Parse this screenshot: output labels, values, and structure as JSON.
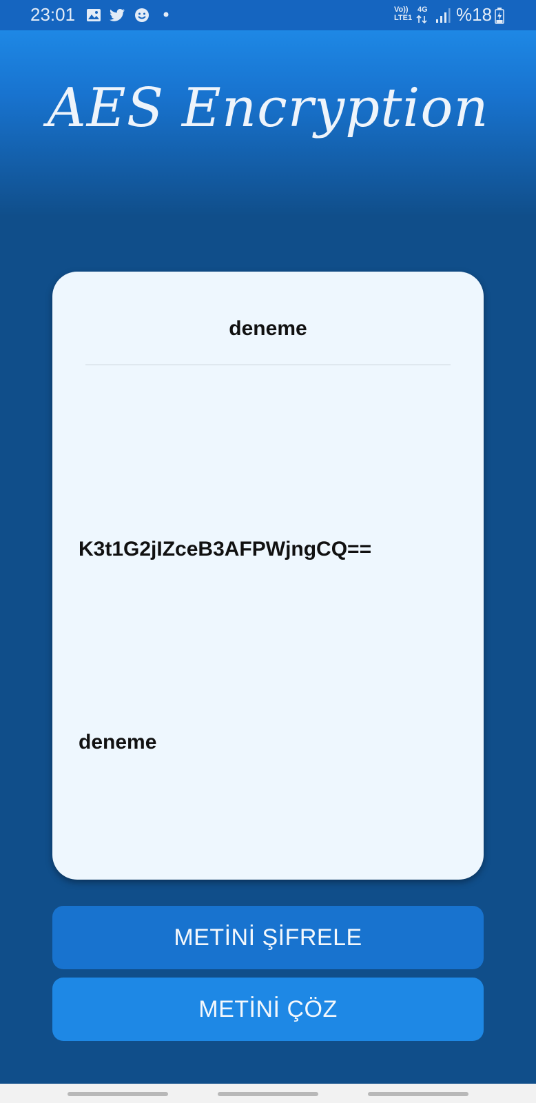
{
  "status_bar": {
    "time": "23:01",
    "notification_icons": [
      "gallery-icon",
      "twitter-icon",
      "smiley-icon",
      "dot-icon"
    ],
    "network_top": "Vo))",
    "network_bottom": "LTE1",
    "data_type": "4G",
    "battery_label": "%18"
  },
  "header": {
    "title": "AES Encryption"
  },
  "card": {
    "input_value": "deneme",
    "encrypted_value": "K3t1G2jIZceB3AFPWjngCQ==",
    "decrypted_value": "deneme"
  },
  "buttons": {
    "encrypt_label": "METİNİ ŞİFRELE",
    "decrypt_label": "METİNİ ÇÖZ"
  },
  "colors": {
    "status_bar": "#1565c0",
    "background": "#104e8a",
    "card": "#eef7fe",
    "button_encrypt": "#1873cf",
    "button_decrypt": "#1e88e5"
  }
}
